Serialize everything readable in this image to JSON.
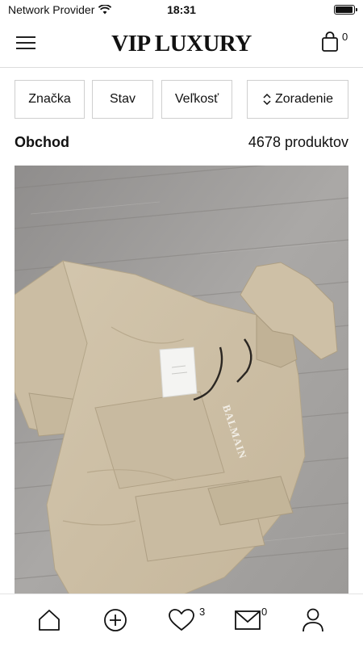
{
  "status_bar": {
    "carrier": "Network Provider",
    "time": "18:31",
    "battery_level": 0.95
  },
  "header": {
    "logo_text": "VIP LUXURY",
    "cart_count": "0"
  },
  "filters": {
    "brand_label": "Značka",
    "condition_label": "Stav",
    "size_label": "Veľkosť",
    "sort_label": "Zoradenie"
  },
  "shop": {
    "title": "Obchod",
    "count_text": "4678 produktov"
  },
  "product": {
    "garment_color": "#cdbfa6",
    "floor_color": "#a2a09e",
    "print_text": "BALMAIN"
  },
  "bottom_nav": {
    "favorites_count": "3",
    "messages_count": "0"
  },
  "colors": {
    "text": "#111111",
    "border": "#cfcfcf",
    "background": "#ffffff"
  }
}
